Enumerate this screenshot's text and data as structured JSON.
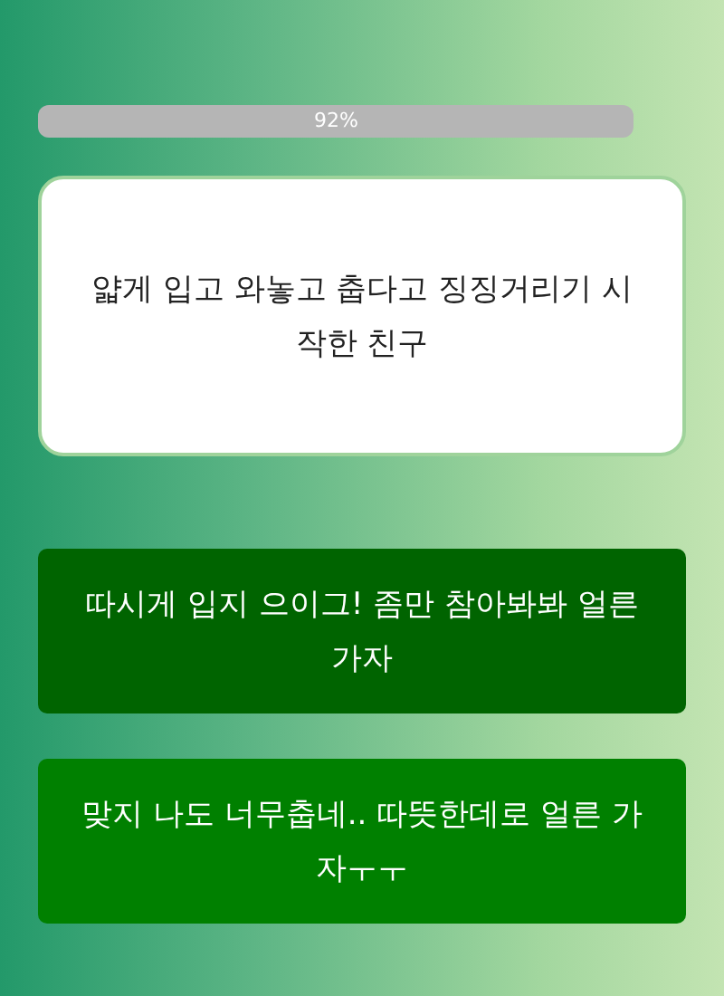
{
  "progress": {
    "label": "92%",
    "level": 0.92
  },
  "question": "얇게 입고 와놓고 춥다고 징징거리기 시작한 친구",
  "answers": [
    {
      "text": "따시게 입지 으이그! 좀만 참아봐봐 얼른 가자",
      "color": "#006400"
    },
    {
      "text": "맞지 나도 너무춥네.. 따뜻한데로 얼른 가자ㅜㅜ",
      "color": "#008000"
    }
  ]
}
